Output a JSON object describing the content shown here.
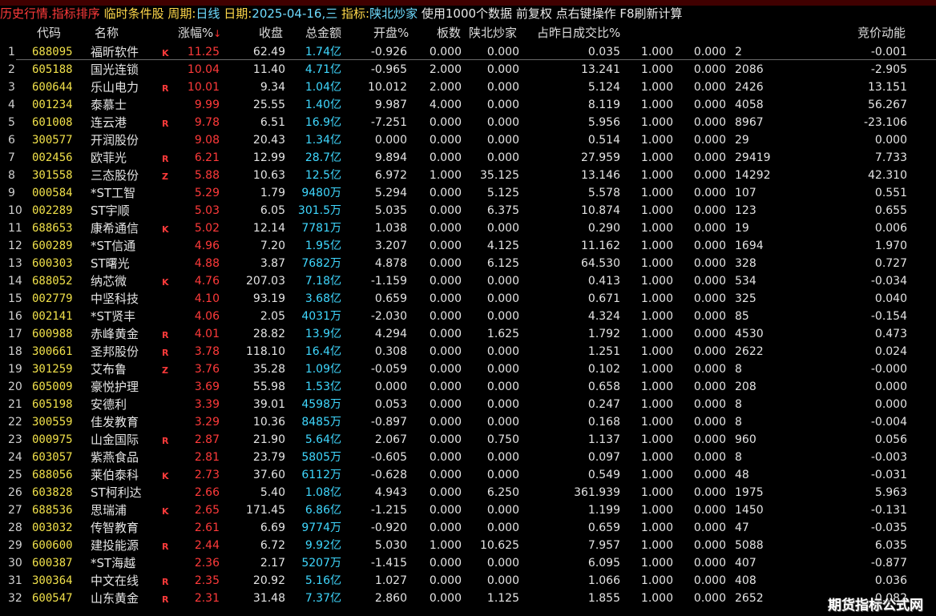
{
  "title_bar": {
    "mode": "历史行情.指标排序",
    "condition": "临时条件股",
    "period_label": "周期:",
    "period_value": "日线",
    "date_label": "日期:",
    "date_value": "2025-04-16,三",
    "indicator_label": "指标:",
    "indicator_value": "陕北炒家",
    "info": "使用1000个数据 前复权 点右键操作 F8刷新计算"
  },
  "columns": {
    "code": "代码",
    "name": "名称",
    "change_pct": "涨幅%",
    "sort_arrow": "↓",
    "close": "收盘",
    "amount": "总金额",
    "open_pct": "开盘%",
    "boards": "板数",
    "indicator": "陕北炒家",
    "vol_ratio": "占昨日成交比%",
    "auction": "竞价动能"
  },
  "colors": {
    "title_red": "#ff3a3a",
    "title_yellow": "#ffd84a",
    "code_yellow": "#f0e04a",
    "pct_red": "#ff3a3a",
    "amount_cyan": "#3fd8ff",
    "background": "#000000"
  },
  "rows": [
    {
      "idx": "1",
      "code": "688095",
      "name": "福昕软件",
      "tag": "K",
      "pct": "11.25",
      "close": "62.49",
      "amt": "1.74亿",
      "open": "-0.926",
      "board": "0.000",
      "sxcj": "0.000",
      "ratio": "0.035",
      "v1": "1.000",
      "v2": "0.000",
      "v3": "2",
      "auc": "-0.001"
    },
    {
      "idx": "2",
      "code": "605188",
      "name": "国光连锁",
      "tag": "",
      "pct": "10.04",
      "close": "11.40",
      "amt": "4.71亿",
      "open": "-0.965",
      "board": "2.000",
      "sxcj": "0.000",
      "ratio": "13.241",
      "v1": "1.000",
      "v2": "0.000",
      "v3": "2086",
      "auc": "-2.905"
    },
    {
      "idx": "3",
      "code": "600644",
      "name": "乐山电力",
      "tag": "R",
      "pct": "10.01",
      "close": "9.34",
      "amt": "1.04亿",
      "open": "10.012",
      "board": "2.000",
      "sxcj": "0.000",
      "ratio": "5.124",
      "v1": "1.000",
      "v2": "0.000",
      "v3": "2426",
      "auc": "13.151"
    },
    {
      "idx": "4",
      "code": "001234",
      "name": "泰慕士",
      "tag": "",
      "pct": "9.99",
      "close": "25.55",
      "amt": "1.40亿",
      "open": "9.987",
      "board": "4.000",
      "sxcj": "0.000",
      "ratio": "8.119",
      "v1": "1.000",
      "v2": "0.000",
      "v3": "4058",
      "auc": "56.267"
    },
    {
      "idx": "5",
      "code": "601008",
      "name": "连云港",
      "tag": "R",
      "pct": "9.78",
      "close": "6.51",
      "amt": "16.9亿",
      "open": "-7.251",
      "board": "0.000",
      "sxcj": "0.000",
      "ratio": "5.956",
      "v1": "1.000",
      "v2": "0.000",
      "v3": "8967",
      "auc": "-23.106"
    },
    {
      "idx": "6",
      "code": "300577",
      "name": "开润股份",
      "tag": "",
      "pct": "9.08",
      "close": "20.43",
      "amt": "1.34亿",
      "open": "0.000",
      "board": "0.000",
      "sxcj": "0.000",
      "ratio": "0.514",
      "v1": "1.000",
      "v2": "0.000",
      "v3": "29",
      "auc": "0.000"
    },
    {
      "idx": "7",
      "code": "002456",
      "name": "欧菲光",
      "tag": "R",
      "pct": "6.21",
      "close": "12.99",
      "amt": "28.7亿",
      "open": "9.894",
      "board": "0.000",
      "sxcj": "0.000",
      "ratio": "27.959",
      "v1": "1.000",
      "v2": "0.000",
      "v3": "29419",
      "auc": "7.733"
    },
    {
      "idx": "8",
      "code": "301558",
      "name": "三态股份",
      "tag": "Z",
      "pct": "5.88",
      "close": "10.63",
      "amt": "12.5亿",
      "open": "6.972",
      "board": "1.000",
      "sxcj": "35.125",
      "ratio": "13.146",
      "v1": "1.000",
      "v2": "0.000",
      "v3": "14292",
      "auc": "42.310"
    },
    {
      "idx": "9",
      "code": "000584",
      "name": "*ST工智",
      "tag": "",
      "pct": "5.29",
      "close": "1.79",
      "amt": "9480万",
      "open": "5.294",
      "board": "0.000",
      "sxcj": "5.125",
      "ratio": "5.578",
      "v1": "1.000",
      "v2": "0.000",
      "v3": "107",
      "auc": "0.551"
    },
    {
      "idx": "10",
      "code": "002289",
      "name": "ST宇顺",
      "tag": "",
      "pct": "5.03",
      "close": "6.05",
      "amt": "301.5万",
      "open": "5.035",
      "board": "0.000",
      "sxcj": "6.375",
      "ratio": "10.874",
      "v1": "1.000",
      "v2": "0.000",
      "v3": "123",
      "auc": "0.655"
    },
    {
      "idx": "11",
      "code": "688653",
      "name": "康希通信",
      "tag": "K",
      "pct": "5.02",
      "close": "12.14",
      "amt": "7781万",
      "open": "1.038",
      "board": "0.000",
      "sxcj": "0.000",
      "ratio": "0.290",
      "v1": "1.000",
      "v2": "0.000",
      "v3": "19",
      "auc": "0.006"
    },
    {
      "idx": "12",
      "code": "600289",
      "name": "*ST信通",
      "tag": "",
      "pct": "4.96",
      "close": "7.20",
      "amt": "1.95亿",
      "open": "3.207",
      "board": "0.000",
      "sxcj": "4.125",
      "ratio": "11.162",
      "v1": "1.000",
      "v2": "0.000",
      "v3": "1694",
      "auc": "1.970"
    },
    {
      "idx": "13",
      "code": "600303",
      "name": "ST曙光",
      "tag": "",
      "pct": "4.88",
      "close": "3.87",
      "amt": "7682万",
      "open": "4.878",
      "board": "0.000",
      "sxcj": "6.125",
      "ratio": "64.530",
      "v1": "1.000",
      "v2": "0.000",
      "v3": "328",
      "auc": "0.727"
    },
    {
      "idx": "14",
      "code": "688052",
      "name": "纳芯微",
      "tag": "K",
      "pct": "4.76",
      "close": "207.03",
      "amt": "7.18亿",
      "open": "-1.159",
      "board": "0.000",
      "sxcj": "0.000",
      "ratio": "0.413",
      "v1": "1.000",
      "v2": "0.000",
      "v3": "534",
      "auc": "-0.034"
    },
    {
      "idx": "15",
      "code": "002779",
      "name": "中坚科技",
      "tag": "",
      "pct": "4.10",
      "close": "93.19",
      "amt": "3.68亿",
      "open": "0.659",
      "board": "0.000",
      "sxcj": "0.000",
      "ratio": "0.671",
      "v1": "1.000",
      "v2": "0.000",
      "v3": "325",
      "auc": "0.040"
    },
    {
      "idx": "16",
      "code": "002141",
      "name": "*ST贤丰",
      "tag": "",
      "pct": "4.06",
      "close": "2.05",
      "amt": "4031万",
      "open": "-2.030",
      "board": "0.000",
      "sxcj": "0.000",
      "ratio": "4.324",
      "v1": "1.000",
      "v2": "0.000",
      "v3": "85",
      "auc": "-0.154"
    },
    {
      "idx": "17",
      "code": "600988",
      "name": "赤峰黄金",
      "tag": "R",
      "pct": "4.01",
      "close": "28.82",
      "amt": "13.9亿",
      "open": "4.294",
      "board": "0.000",
      "sxcj": "1.625",
      "ratio": "1.792",
      "v1": "1.000",
      "v2": "0.000",
      "v3": "4530",
      "auc": "0.473"
    },
    {
      "idx": "18",
      "code": "300661",
      "name": "圣邦股份",
      "tag": "R",
      "pct": "3.78",
      "close": "118.10",
      "amt": "16.4亿",
      "open": "0.308",
      "board": "0.000",
      "sxcj": "0.000",
      "ratio": "1.251",
      "v1": "1.000",
      "v2": "0.000",
      "v3": "2622",
      "auc": "0.024"
    },
    {
      "idx": "19",
      "code": "301259",
      "name": "艾布鲁",
      "tag": "Z",
      "pct": "3.76",
      "close": "35.28",
      "amt": "1.09亿",
      "open": "-0.059",
      "board": "0.000",
      "sxcj": "0.000",
      "ratio": "0.102",
      "v1": "1.000",
      "v2": "0.000",
      "v3": "8",
      "auc": "-0.000"
    },
    {
      "idx": "20",
      "code": "605009",
      "name": "豪悦护理",
      "tag": "",
      "pct": "3.69",
      "close": "55.98",
      "amt": "1.53亿",
      "open": "0.000",
      "board": "0.000",
      "sxcj": "0.000",
      "ratio": "0.658",
      "v1": "1.000",
      "v2": "0.000",
      "v3": "208",
      "auc": "0.000"
    },
    {
      "idx": "21",
      "code": "605198",
      "name": "安德利",
      "tag": "",
      "pct": "3.39",
      "close": "39.01",
      "amt": "4598万",
      "open": "0.053",
      "board": "0.000",
      "sxcj": "0.000",
      "ratio": "0.247",
      "v1": "1.000",
      "v2": "0.000",
      "v3": "8",
      "auc": "0.000"
    },
    {
      "idx": "22",
      "code": "300559",
      "name": "佳发教育",
      "tag": "",
      "pct": "3.29",
      "close": "10.36",
      "amt": "8485万",
      "open": "-0.897",
      "board": "0.000",
      "sxcj": "0.000",
      "ratio": "0.168",
      "v1": "1.000",
      "v2": "0.000",
      "v3": "8",
      "auc": "-0.004"
    },
    {
      "idx": "23",
      "code": "000975",
      "name": "山金国际",
      "tag": "R",
      "pct": "2.87",
      "close": "21.90",
      "amt": "5.64亿",
      "open": "2.067",
      "board": "0.000",
      "sxcj": "0.750",
      "ratio": "1.137",
      "v1": "1.000",
      "v2": "0.000",
      "v3": "960",
      "auc": "0.056"
    },
    {
      "idx": "24",
      "code": "603057",
      "name": "紫燕食品",
      "tag": "",
      "pct": "2.81",
      "close": "23.79",
      "amt": "5805万",
      "open": "-0.605",
      "board": "0.000",
      "sxcj": "0.000",
      "ratio": "0.097",
      "v1": "1.000",
      "v2": "0.000",
      "v3": "8",
      "auc": "-0.003"
    },
    {
      "idx": "25",
      "code": "688056",
      "name": "莱伯泰科",
      "tag": "K",
      "pct": "2.73",
      "close": "37.60",
      "amt": "6112万",
      "open": "-0.628",
      "board": "0.000",
      "sxcj": "0.000",
      "ratio": "0.549",
      "v1": "1.000",
      "v2": "0.000",
      "v3": "48",
      "auc": "-0.031"
    },
    {
      "idx": "26",
      "code": "603828",
      "name": "ST柯利达",
      "tag": "",
      "pct": "2.66",
      "close": "5.40",
      "amt": "1.08亿",
      "open": "4.943",
      "board": "0.000",
      "sxcj": "6.250",
      "ratio": "361.939",
      "v1": "1.000",
      "v2": "0.000",
      "v3": "1975",
      "auc": "5.963"
    },
    {
      "idx": "27",
      "code": "688536",
      "name": "思瑞浦",
      "tag": "K",
      "pct": "2.65",
      "close": "171.45",
      "amt": "6.86亿",
      "open": "-1.215",
      "board": "0.000",
      "sxcj": "0.000",
      "ratio": "1.199",
      "v1": "1.000",
      "v2": "0.000",
      "v3": "1450",
      "auc": "-0.131"
    },
    {
      "idx": "28",
      "code": "003032",
      "name": "传智教育",
      "tag": "",
      "pct": "2.61",
      "close": "6.69",
      "amt": "9774万",
      "open": "-0.920",
      "board": "0.000",
      "sxcj": "0.000",
      "ratio": "0.659",
      "v1": "1.000",
      "v2": "0.000",
      "v3": "47",
      "auc": "-0.035"
    },
    {
      "idx": "29",
      "code": "600600",
      "name": "建投能源",
      "tag": "R",
      "pct": "2.44",
      "close": "6.72",
      "amt": "9.92亿",
      "open": "5.030",
      "board": "1.000",
      "sxcj": "10.625",
      "ratio": "7.957",
      "v1": "1.000",
      "v2": "0.000",
      "v3": "5088",
      "auc": "6.035"
    },
    {
      "idx": "30",
      "code": "600387",
      "name": "*ST海越",
      "tag": "",
      "pct": "2.36",
      "close": "2.17",
      "amt": "5207万",
      "open": "-1.415",
      "board": "0.000",
      "sxcj": "0.000",
      "ratio": "6.095",
      "v1": "1.000",
      "v2": "0.000",
      "v3": "407",
      "auc": "-0.877"
    },
    {
      "idx": "31",
      "code": "300364",
      "name": "中文在线",
      "tag": "R",
      "pct": "2.35",
      "close": "20.92",
      "amt": "5.16亿",
      "open": "1.027",
      "board": "0.000",
      "sxcj": "0.000",
      "ratio": "1.066",
      "v1": "1.000",
      "v2": "0.000",
      "v3": "408",
      "auc": "0.036"
    },
    {
      "idx": "32",
      "code": "600547",
      "name": "山东黄金",
      "tag": "R",
      "pct": "2.31",
      "close": "31.48",
      "amt": "7.37亿",
      "open": "2.860",
      "board": "0.000",
      "sxcj": "1.125",
      "ratio": "1.855",
      "v1": "1.000",
      "v2": "0.000",
      "v3": "2652",
      "auc": "0.082"
    }
  ],
  "watermark": "期货指标公式网"
}
